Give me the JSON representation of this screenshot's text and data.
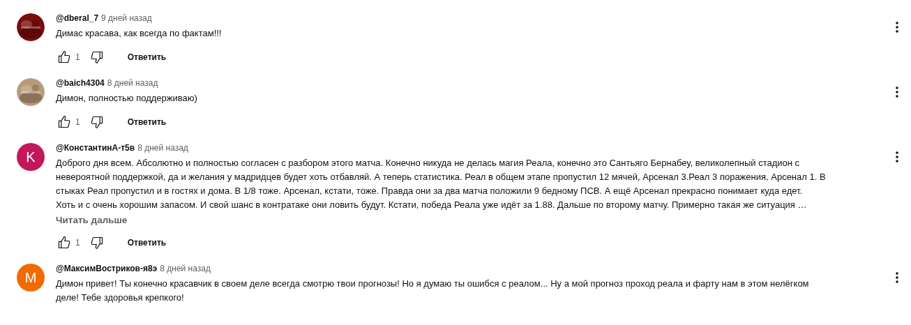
{
  "comments": [
    {
      "author": "@dberal_7",
      "time": "9 дней назад",
      "text": "Димас красава, как всегда по фактам!!!",
      "likes": "1",
      "reply": "Ответить"
    },
    {
      "author": "@baich4304",
      "time": "8 дней назад",
      "text": "Димон, полностью поддерживаю)",
      "likes": "1",
      "reply": "Ответить"
    },
    {
      "avatar": {
        "kind": "letter",
        "letter": "K",
        "color": "#c2185b"
      },
      "author": "@КонстантинА-т5в",
      "time": "8 дней назад",
      "text": "Доброго дня всем. Абсолютно и полностью согласен с разбором этого матча. Конечно никуда не делась магия Реала, конечно это Сантьяго Бернабеу, великолепный стадион с\nневероятной поддержкой, да и желания у мадридцев будет хоть отбавляй. А теперь статистика. Реал в общем этапе пропустил 12 мячей, Арсенал 3.Реал 3 поражения, Арсенал 1. В\nстыках Реал пропустил и в гостях и дома. В 1/8 тоже. Арсенал, кстати, тоже. Правда они за два матча положили 9 бедному ПСВ. А ещё Арсенал прекрасно понимает куда едет.\nХоть и с очень хорошим запасом. И свой шанс в контратаке они ловить будут. Кстати, победа Реала уже идёт за 1.88. Дальше по второму матчу. Примерно такая же ситуация …",
      "more": "Читать дальше",
      "likes": "1",
      "reply": "Ответить"
    },
    {
      "avatar": {
        "kind": "letter",
        "letter": "M",
        "color": "#ef6c00"
      },
      "author": "@МаксимВостриков-я8э",
      "time": "8 дней назад",
      "text": "Димон привет! Ты конечно красавчик в своем деле всегда смотрю твои прогнозы! Но я думаю ты ошибся с реалом... Ну а мой прогноз проход реала и фарту нам в этом нелёгком\nделе! Тебе здоровья крепкого!"
    }
  ]
}
